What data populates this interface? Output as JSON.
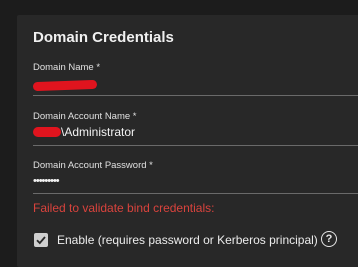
{
  "card": {
    "title": "Domain Credentials"
  },
  "fields": {
    "domain_name": {
      "label": "Domain Name *",
      "value": ""
    },
    "account_name": {
      "label": "Domain Account Name *",
      "value": "\\Administrator"
    },
    "account_password": {
      "label": "Domain Account Password *",
      "value": "•••••••••"
    }
  },
  "error": {
    "message": "Failed to validate bind credentials:"
  },
  "enable": {
    "label": "Enable (requires password or Kerberos principal)",
    "checked": true
  },
  "help": {
    "glyph": "?"
  },
  "colors": {
    "redaction": "#e0141e",
    "error": "#d9433d",
    "panel": "#282828",
    "background": "#1c1c1c"
  }
}
